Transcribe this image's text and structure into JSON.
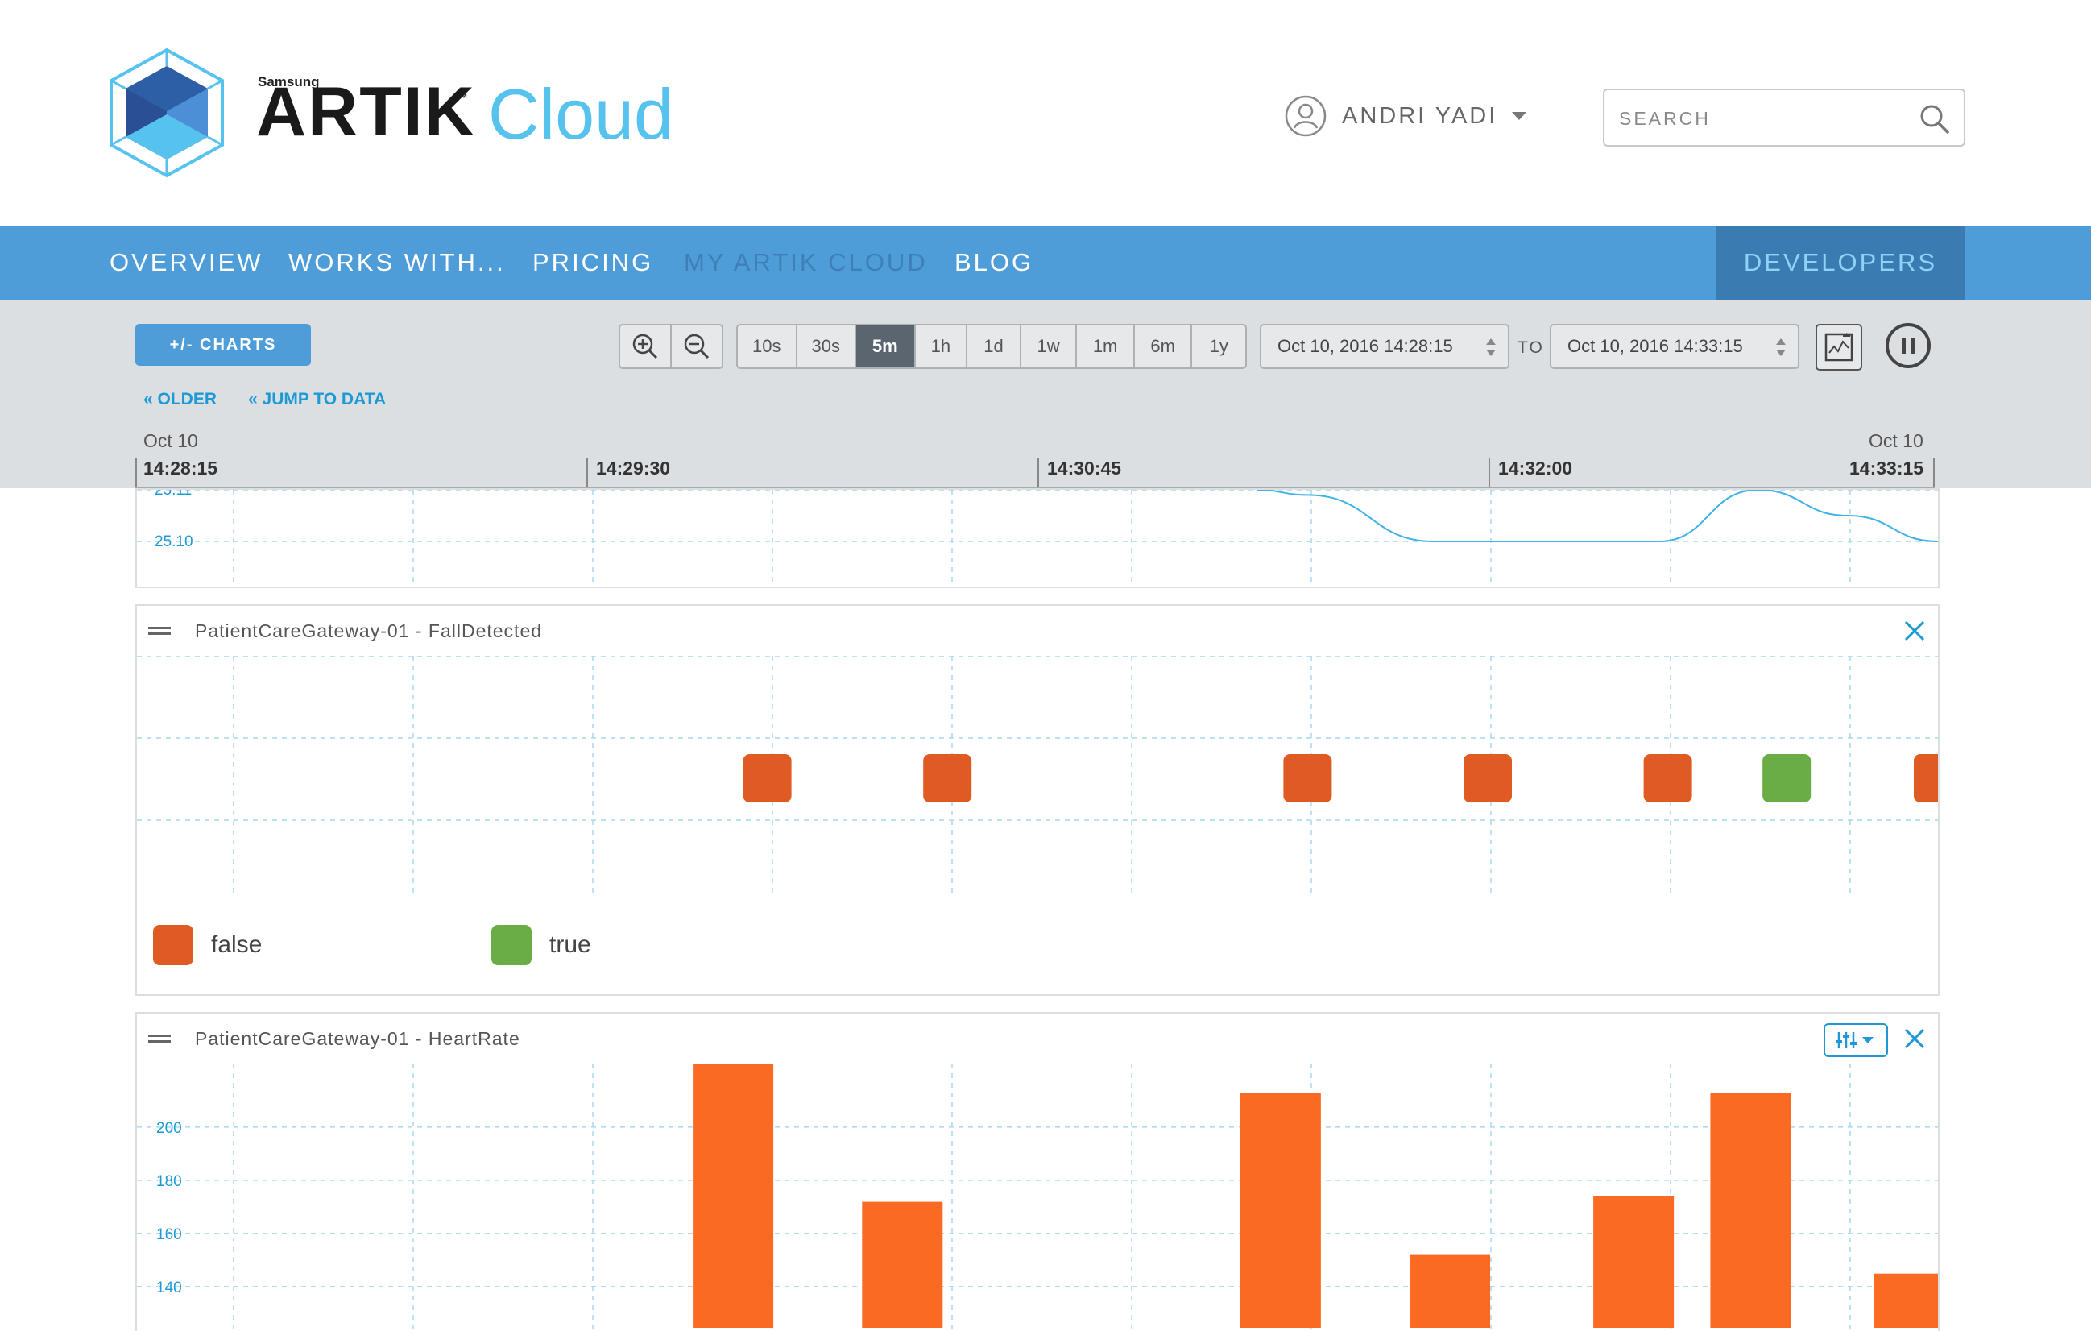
{
  "header": {
    "brand_small": "Samsung",
    "brand_name": "ARTIK",
    "brand_tm": "™",
    "brand_product": "Cloud",
    "user_name": "ANDRI YADI",
    "search_placeholder": "SEARCH"
  },
  "nav": {
    "items": [
      {
        "label": "OVERVIEW"
      },
      {
        "label": "WORKS WITH..."
      },
      {
        "label": "PRICING"
      },
      {
        "label": "MY ARTIK CLOUD"
      },
      {
        "label": "BLOG"
      }
    ],
    "active": "MY ARTIK CLOUD",
    "developers": "DEVELOPERS"
  },
  "toolbar": {
    "charts_button": "+/- CHARTS",
    "ranges": [
      "10s",
      "30s",
      "5m",
      "1h",
      "1d",
      "1w",
      "1m",
      "6m",
      "1y"
    ],
    "active_range": "5m",
    "from_date": "Oct 10, 2016 14:28:15",
    "to_label": "TO",
    "to_date": "Oct 10, 2016 14:33:15",
    "older_link": "« OLDER",
    "jump_link": "« JUMP TO DATA"
  },
  "time_axis": {
    "start_date": "Oct 10",
    "end_date": "Oct 10",
    "ticks": [
      "14:28:15",
      "14:29:30",
      "14:30:45",
      "14:32:00",
      "14:33:15"
    ]
  },
  "colors": {
    "accent": "#4f9dd8",
    "link": "#1d9ad6",
    "false": "#e05a24",
    "true": "#6aad45",
    "heart_bar": "#fb6a22"
  },
  "panels": [
    {
      "chart_data": {
        "type": "line",
        "title": "",
        "y_tick_labels": [
          "25.11",
          "25.10"
        ],
        "series": [
          {
            "points": [
              [
                0.622,
                25.11
              ],
              [
                0.65,
                25.109
              ],
              [
                0.72,
                25.1
              ],
              [
                0.845,
                25.1
              ],
              [
                0.9,
                25.11
              ],
              [
                0.95,
                25.105
              ],
              [
                1.0,
                25.1
              ]
            ]
          }
        ]
      }
    },
    {
      "title": "PatientCareGateway-01 - FallDetected",
      "chart_data": {
        "type": "scatter",
        "title": "PatientCareGateway-01 - FallDetected",
        "legend": [
          "false",
          "true"
        ],
        "points": [
          {
            "t": 0.35,
            "value": "false"
          },
          {
            "t": 0.45,
            "value": "false"
          },
          {
            "t": 0.65,
            "value": "false"
          },
          {
            "t": 0.75,
            "value": "false"
          },
          {
            "t": 0.85,
            "value": "false"
          },
          {
            "t": 0.916,
            "value": "true"
          },
          {
            "t": 1.0,
            "value": "false"
          }
        ]
      }
    },
    {
      "title": "PatientCareGateway-01 - HeartRate",
      "chart_data": {
        "type": "bar",
        "title": "PatientCareGateway-01 - HeartRate",
        "y_ticks": [
          200,
          180,
          160,
          140
        ],
        "bars": [
          {
            "t": 0.331,
            "value": 213
          },
          {
            "t": 0.425,
            "value": 161
          },
          {
            "t": 0.635,
            "value": 202
          },
          {
            "t": 0.729,
            "value": 141
          },
          {
            "t": 0.831,
            "value": 163
          },
          {
            "t": 0.896,
            "value": 202
          },
          {
            "t": 0.987,
            "value": 134
          }
        ]
      }
    }
  ]
}
